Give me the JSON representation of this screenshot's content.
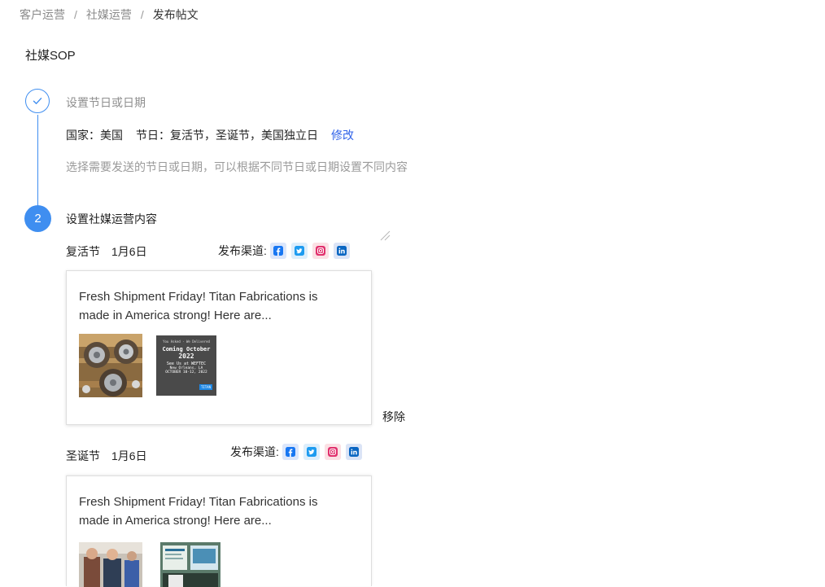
{
  "breadcrumb": {
    "items": [
      "客户运营",
      "社媒运营"
    ],
    "current": "发布帖文",
    "separator": "/"
  },
  "page_title": "社媒SOP",
  "steps": {
    "step1": {
      "title": "设置节日或日期",
      "info_country": "国家：美国",
      "info_holidays": "节日：复活节，圣诞节，美国独立日",
      "edit_label": "修改",
      "description": "选择需要发送的节日或日期，可以根据不同节日或日期设置不同内容"
    },
    "step2": {
      "number": "2",
      "title": "设置社媒运营内容"
    }
  },
  "entries": [
    {
      "holiday": "复活节",
      "date": "1月6日",
      "channel_label": "发布渠道:",
      "post_text": "Fresh Shipment Friday! Titan Fabrications is made in America strong! Here are...",
      "thumb2": {
        "line1": "You Asked · We Delivered",
        "line2": "Coming October",
        "line3": "2022",
        "line4": "See Us at WEFTEC",
        "line5": "New Orleans, LA",
        "line6": "OCTOBER 10-12, 2022",
        "logo": "TITAN"
      }
    },
    {
      "holiday": "圣诞节",
      "date": "1月6日",
      "channel_label": "发布渠道:",
      "post_text": "Fresh Shipment Friday! Titan Fabrications is made in America strong! Here are..."
    }
  ],
  "remove_label": "移除",
  "colors": {
    "primary": "#3f8ef0",
    "link": "#2f62e8",
    "facebook": "#1877f2",
    "twitter": "#1d9bf0",
    "instagram": "#e1306c",
    "linkedin": "#0a66c2"
  },
  "icons": [
    "check-icon",
    "facebook-icon",
    "twitter-icon",
    "instagram-icon",
    "linkedin-icon",
    "resize-handle-icon"
  ]
}
